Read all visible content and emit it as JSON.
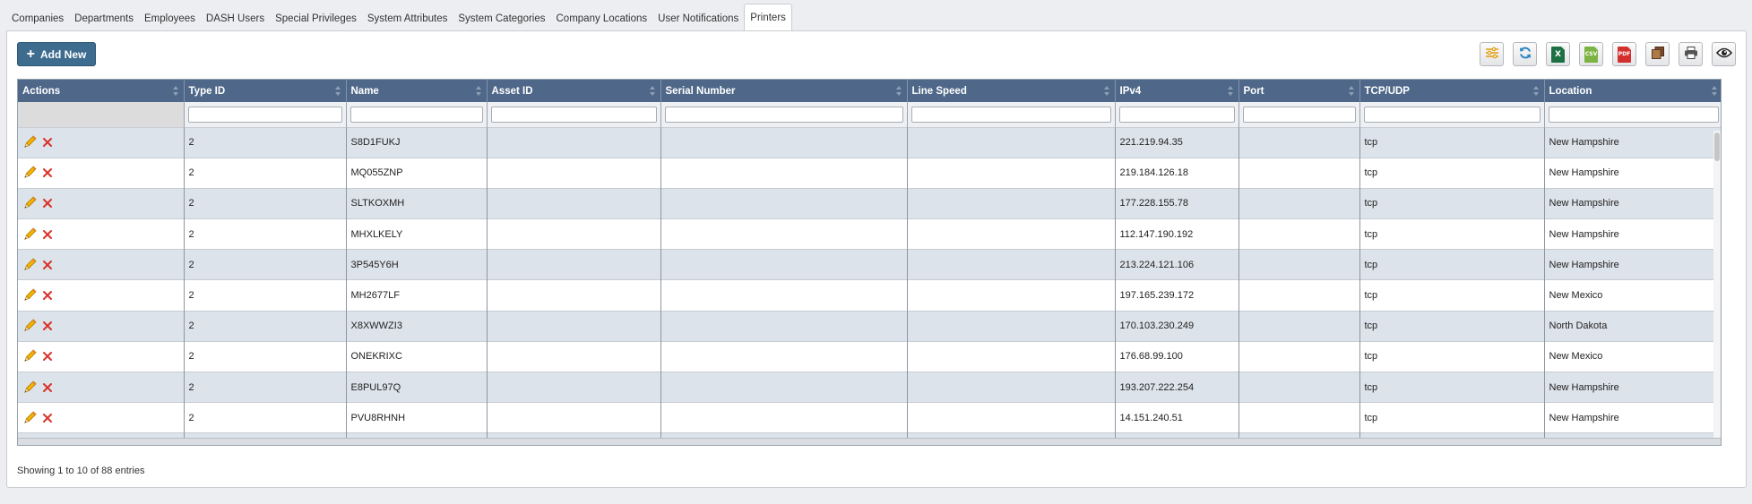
{
  "tabs": [
    {
      "label": "Companies",
      "active": false
    },
    {
      "label": "Departments",
      "active": false
    },
    {
      "label": "Employees",
      "active": false
    },
    {
      "label": "DASH Users",
      "active": false
    },
    {
      "label": "Special Privileges",
      "active": false
    },
    {
      "label": "System Attributes",
      "active": false
    },
    {
      "label": "System Categories",
      "active": false
    },
    {
      "label": "Company Locations",
      "active": false
    },
    {
      "label": "User Notifications",
      "active": false
    },
    {
      "label": "Printers",
      "active": true
    }
  ],
  "add_button": {
    "label": "Add New"
  },
  "toolbar": [
    {
      "name": "column-settings-icon"
    },
    {
      "name": "refresh-icon"
    },
    {
      "name": "excel-export-icon",
      "text": "X",
      "color": "#1d7044"
    },
    {
      "name": "csv-export-icon",
      "text": "CSV",
      "color": "#7cb342"
    },
    {
      "name": "pdf-export-icon",
      "text": "PDF",
      "color": "#d32f2f"
    },
    {
      "name": "copy-icon"
    },
    {
      "name": "print-icon"
    },
    {
      "name": "view-icon"
    }
  ],
  "table": {
    "columns": [
      "Actions",
      "Type ID",
      "Name",
      "Asset ID",
      "Serial Number",
      "Line Speed",
      "IPv4",
      "Port",
      "TCP/UDP",
      "Location"
    ],
    "rows": [
      {
        "type_id": "2",
        "name": "S8D1FUKJ",
        "asset_id": "",
        "serial_number": "",
        "line_speed": "",
        "ipv4": "221.219.94.35",
        "port": "",
        "protocol": "tcp",
        "location": "New Hampshire"
      },
      {
        "type_id": "2",
        "name": "MQ055ZNP",
        "asset_id": "",
        "serial_number": "",
        "line_speed": "",
        "ipv4": "219.184.126.18",
        "port": "",
        "protocol": "tcp",
        "location": "New Hampshire"
      },
      {
        "type_id": "2",
        "name": "SLTKOXMH",
        "asset_id": "",
        "serial_number": "",
        "line_speed": "",
        "ipv4": "177.228.155.78",
        "port": "",
        "protocol": "tcp",
        "location": "New Hampshire"
      },
      {
        "type_id": "2",
        "name": "MHXLKELY",
        "asset_id": "",
        "serial_number": "",
        "line_speed": "",
        "ipv4": "112.147.190.192",
        "port": "",
        "protocol": "tcp",
        "location": "New Hampshire"
      },
      {
        "type_id": "2",
        "name": "3P545Y6H",
        "asset_id": "",
        "serial_number": "",
        "line_speed": "",
        "ipv4": "213.224.121.106",
        "port": "",
        "protocol": "tcp",
        "location": "New Hampshire"
      },
      {
        "type_id": "2",
        "name": "MH2677LF",
        "asset_id": "",
        "serial_number": "",
        "line_speed": "",
        "ipv4": "197.165.239.172",
        "port": "",
        "protocol": "tcp",
        "location": "New Mexico"
      },
      {
        "type_id": "2",
        "name": "X8XWWZI3",
        "asset_id": "",
        "serial_number": "",
        "line_speed": "",
        "ipv4": "170.103.230.249",
        "port": "",
        "protocol": "tcp",
        "location": "North Dakota"
      },
      {
        "type_id": "2",
        "name": "ONEKRIXC",
        "asset_id": "",
        "serial_number": "",
        "line_speed": "",
        "ipv4": "176.68.99.100",
        "port": "",
        "protocol": "tcp",
        "location": "New Mexico"
      },
      {
        "type_id": "2",
        "name": "E8PUL97Q",
        "asset_id": "",
        "serial_number": "",
        "line_speed": "",
        "ipv4": "193.207.222.254",
        "port": "",
        "protocol": "tcp",
        "location": "New Hampshire"
      },
      {
        "type_id": "2",
        "name": "PVU8RHNH",
        "asset_id": "",
        "serial_number": "",
        "line_speed": "",
        "ipv4": "14.151.240.51",
        "port": "",
        "protocol": "tcp",
        "location": "New Hampshire"
      }
    ]
  },
  "footer": {
    "info": "Showing 1 to 10 of 88 entries"
  }
}
